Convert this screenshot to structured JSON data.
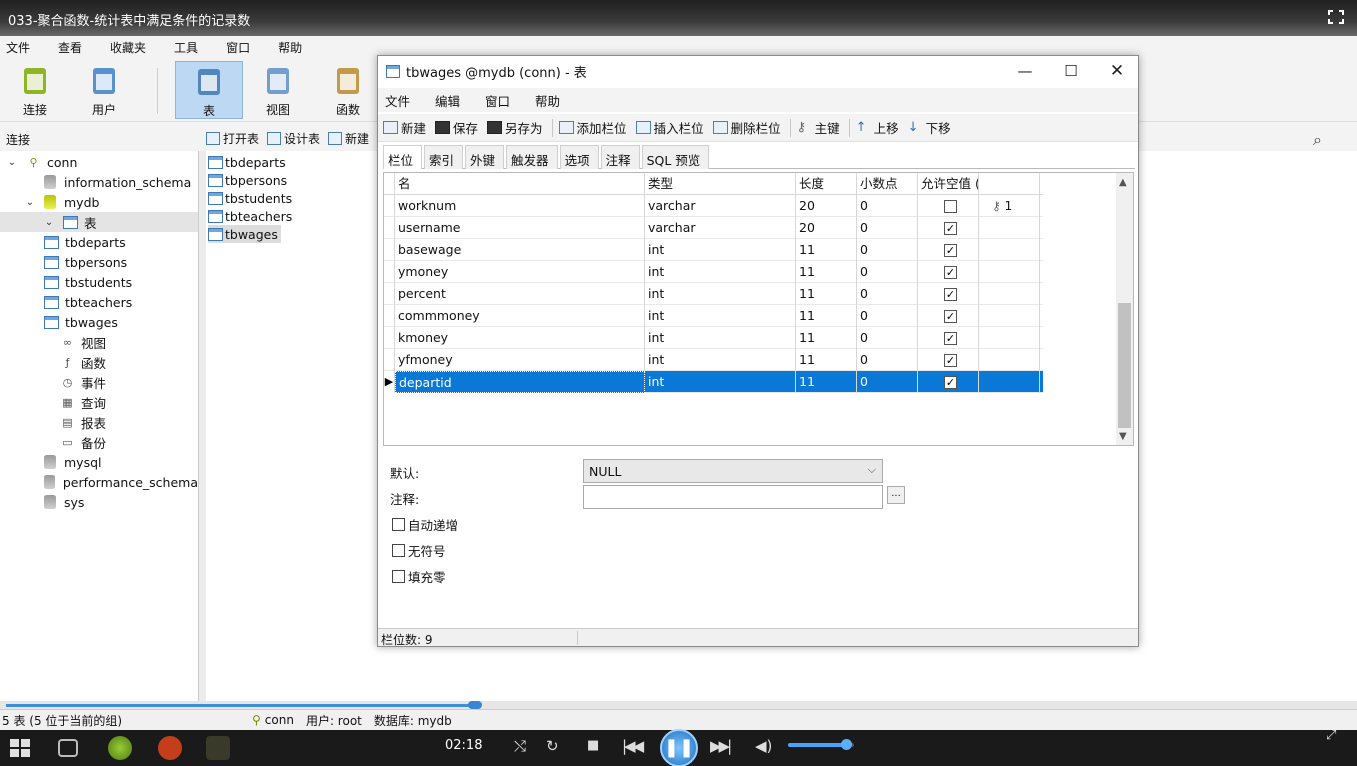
{
  "video": {
    "title": "033-聚合函数-统计表中满足条件的记录数",
    "time": "02:18",
    "progress": 0.35,
    "volume": 0.9
  },
  "app": {
    "menu": [
      "文件",
      "查看",
      "收藏夹",
      "工具",
      "窗口",
      "帮助"
    ],
    "toolbar": [
      {
        "label": "连接",
        "icon": "plug-icon"
      },
      {
        "label": "用户",
        "icon": "user-icon"
      },
      {
        "label": "表",
        "icon": "table-icon",
        "active": true
      },
      {
        "label": "视图",
        "icon": "view-icon"
      },
      {
        "label": "函数",
        "icon": "function-icon"
      }
    ],
    "conn_header": "连接",
    "object_toolbar": [
      "打开表",
      "设计表",
      "新建"
    ],
    "tree": [
      {
        "label": "conn",
        "level": 0,
        "type": "conn",
        "twisty": "v"
      },
      {
        "label": "information_schema",
        "level": 1,
        "type": "db"
      },
      {
        "label": "mydb",
        "level": 1,
        "type": "db-open",
        "twisty": "v"
      },
      {
        "label": "表",
        "level": 2,
        "type": "table",
        "twisty": "v",
        "selected": true
      },
      {
        "label": "tbdeparts",
        "level": 3,
        "type": "table"
      },
      {
        "label": "tbpersons",
        "level": 3,
        "type": "table"
      },
      {
        "label": "tbstudents",
        "level": 3,
        "type": "table"
      },
      {
        "label": "tbteachers",
        "level": 3,
        "type": "table"
      },
      {
        "label": "tbwages",
        "level": 3,
        "type": "table"
      },
      {
        "label": "视图",
        "level": 2,
        "type": "misc",
        "glyph": "∞"
      },
      {
        "label": "函数",
        "level": 2,
        "type": "misc",
        "glyph": "ƒ"
      },
      {
        "label": "事件",
        "level": 2,
        "type": "misc",
        "glyph": "◷"
      },
      {
        "label": "查询",
        "level": 2,
        "type": "misc",
        "glyph": "▦"
      },
      {
        "label": "报表",
        "level": 2,
        "type": "misc",
        "glyph": "▤"
      },
      {
        "label": "备份",
        "level": 2,
        "type": "misc",
        "glyph": "▭"
      },
      {
        "label": "mysql",
        "level": 1,
        "type": "db"
      },
      {
        "label": "performance_schema",
        "level": 1,
        "type": "db"
      },
      {
        "label": "sys",
        "level": 1,
        "type": "db"
      }
    ],
    "table_list": [
      "tbdeparts",
      "tbpersons",
      "tbstudents",
      "tbteachers",
      "tbwages"
    ],
    "status": {
      "count": "5 表 (5 位于当前的组)",
      "conn": "conn",
      "user": "用户: root",
      "db": "数据库: mydb"
    }
  },
  "window": {
    "title": "tbwages @mydb (conn) - 表",
    "menu": [
      "文件",
      "编辑",
      "窗口",
      "帮助"
    ],
    "tools": [
      "新建",
      "保存",
      "另存为",
      "添加栏位",
      "插入栏位",
      "删除栏位",
      "主键",
      "上移",
      "下移"
    ],
    "tabs": [
      "栏位",
      "索引",
      "外键",
      "触发器",
      "选项",
      "注释",
      "SQL 预览"
    ],
    "columns": [
      "名",
      "类型",
      "长度",
      "小数点",
      "允许空值 (",
      ""
    ],
    "rows": [
      {
        "name": "worknum",
        "type": "varchar",
        "len": "20",
        "dec": "0",
        "nullable": false,
        "key": "1"
      },
      {
        "name": "username",
        "type": "varchar",
        "len": "20",
        "dec": "0",
        "nullable": true,
        "key": ""
      },
      {
        "name": "basewage",
        "type": "int",
        "len": "11",
        "dec": "0",
        "nullable": true,
        "key": ""
      },
      {
        "name": "ymoney",
        "type": "int",
        "len": "11",
        "dec": "0",
        "nullable": true,
        "key": ""
      },
      {
        "name": "percent",
        "type": "int",
        "len": "11",
        "dec": "0",
        "nullable": true,
        "key": ""
      },
      {
        "name": "commmoney",
        "type": "int",
        "len": "11",
        "dec": "0",
        "nullable": true,
        "key": ""
      },
      {
        "name": "kmoney",
        "type": "int",
        "len": "11",
        "dec": "0",
        "nullable": true,
        "key": ""
      },
      {
        "name": "yfmoney",
        "type": "int",
        "len": "11",
        "dec": "0",
        "nullable": true,
        "key": ""
      },
      {
        "name": "departid",
        "type": "int",
        "len": "11",
        "dec": "0",
        "nullable": true,
        "key": "",
        "selected": true
      }
    ],
    "props": {
      "default_label": "默认:",
      "default_value": "NULL",
      "comment_label": "注释:",
      "comment_value": "",
      "more_label": "...",
      "checks": [
        "自动递增",
        "无符号",
        "填充零"
      ]
    },
    "status": "栏位数: 9"
  },
  "colors": {
    "accent": "#0a78d7",
    "active_tool": "#bcd8f2"
  }
}
